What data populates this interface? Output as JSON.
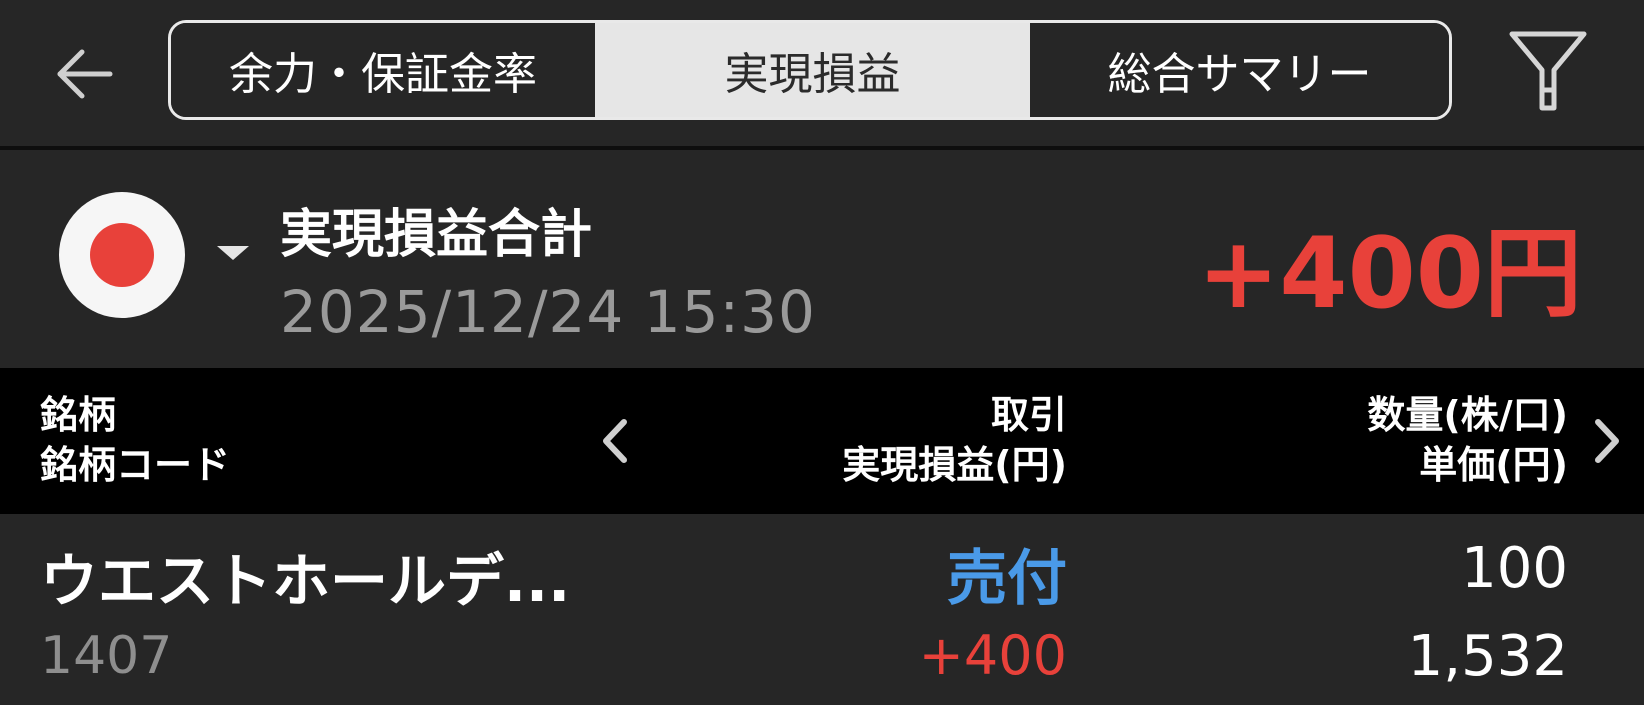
{
  "header": {
    "tabs": [
      {
        "label": "余力・保証金率",
        "active": false
      },
      {
        "label": "実現損益",
        "active": true
      },
      {
        "label": "総合サマリー",
        "active": false
      }
    ]
  },
  "summary": {
    "title": "実現損益合計",
    "datetime": "2025/12/24  15:30",
    "amount": "+400円",
    "market_flag": "japan-flag-icon"
  },
  "table": {
    "columns": {
      "left": [
        "銘柄",
        "銘柄コード"
      ],
      "middle": [
        "取引",
        "実現損益(円)"
      ],
      "right": [
        "数量(株/口)",
        "単価(円)"
      ]
    },
    "rows": [
      {
        "name": "ウエストホールデ...",
        "code": "1407",
        "trade": "売付",
        "pl": "+400",
        "quantity": "100",
        "price": "1,532"
      }
    ]
  },
  "colors": {
    "background": "#262626",
    "header_bar": "#000000",
    "profit_red": "#e8413a",
    "sell_blue": "#4a9ae8",
    "active_tab": "#e6e6e6"
  }
}
